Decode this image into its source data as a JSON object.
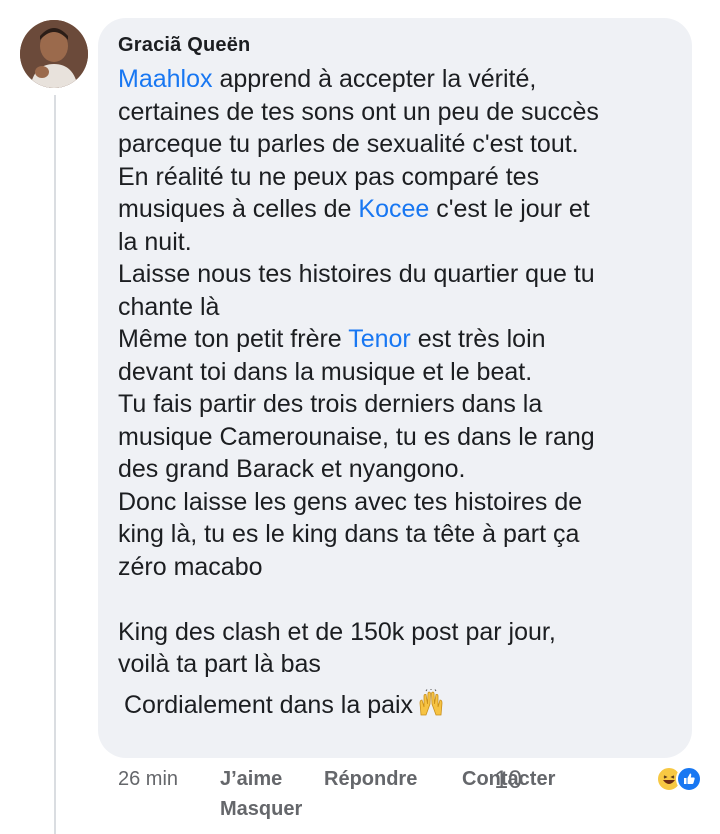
{
  "comment": {
    "author": "Graciã Queën",
    "lines": [
      [
        {
          "text": "Maahlox",
          "mention": true
        },
        {
          "text": " apprend à accepter la vérité,"
        }
      ],
      [
        {
          "text": "certaines de tes sons ont un peu de succès"
        }
      ],
      [
        {
          "text": "parceque tu parles de sexualité c'est tout."
        }
      ],
      [
        {
          "text": "En réalité tu ne peux pas comparé tes"
        }
      ],
      [
        {
          "text": "musiques à celles de "
        },
        {
          "text": "Kocee",
          "mention": true
        },
        {
          "text": " c'est le jour et"
        }
      ],
      [
        {
          "text": "la nuit."
        }
      ],
      [
        {
          "text": "Laisse nous tes histoires du quartier que tu"
        }
      ],
      [
        {
          "text": "chante là"
        }
      ],
      [
        {
          "text": "Même ton petit frère "
        },
        {
          "text": "Tenor",
          "mention": true
        },
        {
          "text": " est très loin"
        }
      ],
      [
        {
          "text": "devant toi dans la musique et le beat."
        }
      ],
      [
        {
          "text": "Tu fais partir des trois derniers dans la"
        }
      ],
      [
        {
          "text": "musique Camerounaise, tu es dans le rang"
        }
      ],
      [
        {
          "text": "des grand Barack et nyangono."
        }
      ],
      [
        {
          "text": "Donc laisse les gens avec tes histoires de"
        }
      ],
      [
        {
          "text": "king là, tu es le king dans ta tête à part ça"
        }
      ],
      [
        {
          "text": "zéro macabo"
        }
      ],
      [],
      [
        {
          "text": "King des clash et de 150k post par jour,"
        }
      ],
      [
        {
          "text": "voilà ta part là bas"
        }
      ]
    ],
    "signoff": "Cordialement dans la paix",
    "signoff_emoji": "raising-hands-emoji"
  },
  "actions": {
    "time": "26 min",
    "like_label": "J’aime",
    "reply_label": "Répondre",
    "contact_label": "Contacter",
    "hide_label": "Masquer"
  },
  "reactions": {
    "count": "10",
    "types": [
      "haha-reaction-icon",
      "like-reaction-icon"
    ]
  },
  "colors": {
    "bubble": "#eff1f5",
    "mention": "#1877f2",
    "secondary_text": "#65676b",
    "like_blue": "#1877f2",
    "haha_yellow": "#f7c843"
  }
}
